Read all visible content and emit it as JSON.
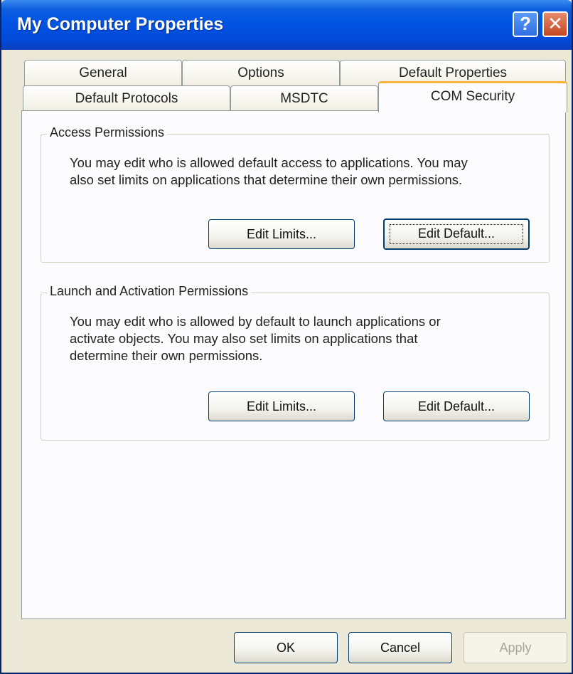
{
  "window": {
    "title": "My Computer Properties"
  },
  "titlebar": {
    "help_glyph": "?",
    "close_glyph": "✕"
  },
  "tabs": {
    "row1": [
      "General",
      "Options",
      "Default Properties"
    ],
    "row2": [
      "Default Protocols",
      "MSDTC",
      "COM Security"
    ],
    "active": "COM Security"
  },
  "access": {
    "title": "Access Permissions",
    "description_line1": "You may edit who is allowed default access to applications. You may",
    "description_line2": "also set limits on applications that determine their own permissions.",
    "edit_limits_label": "Edit Limits...",
    "edit_default_label": "Edit Default..."
  },
  "launch": {
    "title": "Launch and Activation Permissions",
    "description_line1": "You may edit who is allowed by default to launch applications or",
    "description_line2": "activate objects. You may also set limits on applications that",
    "description_line3": "determine their own permissions.",
    "edit_limits_label": "Edit Limits...",
    "edit_default_label": "Edit Default..."
  },
  "footer": {
    "ok_label": "OK",
    "cancel_label": "Cancel",
    "apply_label": "Apply"
  },
  "colors": {
    "titlebar_blue": "#0054E3",
    "dialog_bg": "#ECE9D8",
    "panel_bg": "#FCFCFE",
    "active_tab_accent": "#F8B33A"
  }
}
